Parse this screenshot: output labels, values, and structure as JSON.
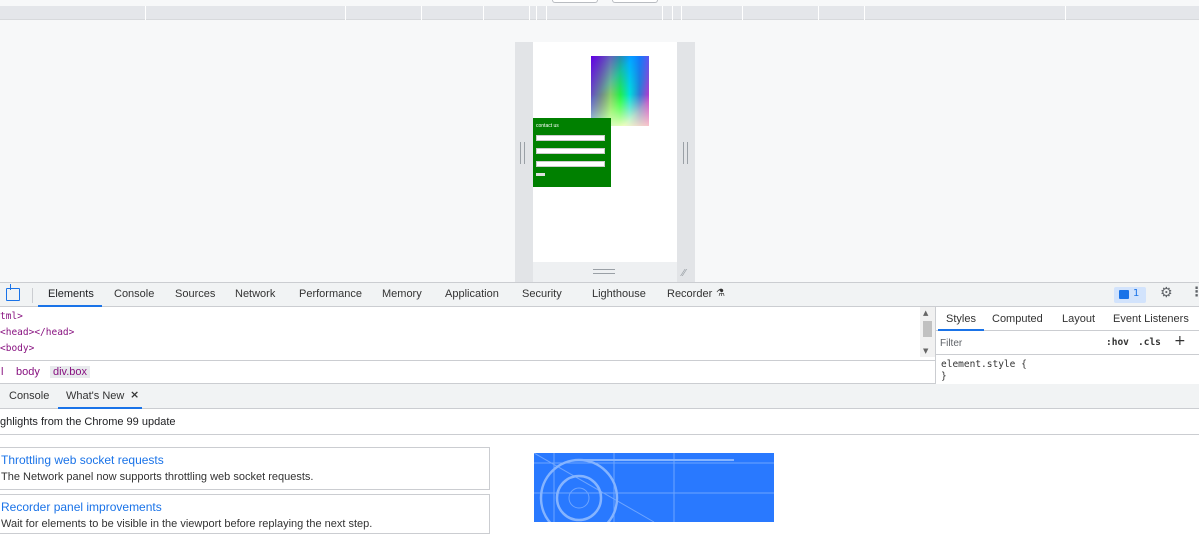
{
  "devtools": {
    "tabs": [
      "Elements",
      "Console",
      "Sources",
      "Network",
      "Performance",
      "Memory",
      "Application",
      "Security",
      "Lighthouse",
      "Recorder"
    ],
    "issues_count": "1"
  },
  "device": {
    "form_title": "contact us"
  },
  "dom": {
    "lines": [
      "tml>",
      "<head></head>",
      "<body>"
    ]
  },
  "breadcrumbs": [
    "l",
    "body",
    "div.box"
  ],
  "styles": {
    "tabs": [
      "Styles",
      "Computed",
      "Layout",
      "Event Listeners"
    ],
    "filter_placeholder": "Filter",
    "hov": ":hov",
    "cls": ".cls",
    "plus": "+",
    "rule_selector": "element.style {",
    "rule_close": "}"
  },
  "drawer": {
    "tabs": [
      "Console",
      "What's New"
    ],
    "close": "×",
    "highlights": "ghlights from the Chrome 99 update",
    "cards": [
      {
        "title": "Throttling web socket requests",
        "desc": "The Network panel now supports throttling web socket requests."
      },
      {
        "title": "Recorder panel improvements",
        "desc": "Wait for elements to be visible in the viewport before replaying the next step."
      }
    ]
  }
}
